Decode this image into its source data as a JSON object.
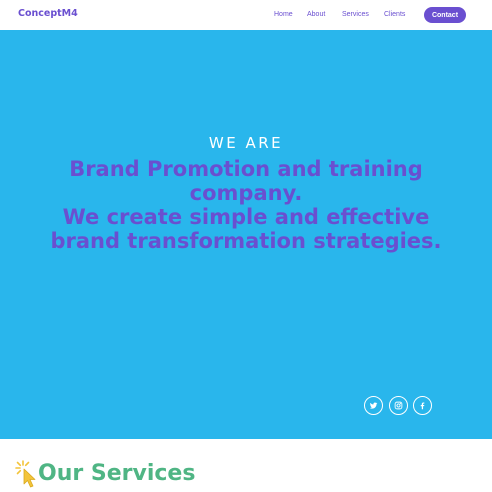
{
  "navbar": {
    "logo": "ConceptM4",
    "links": [
      "Home",
      "About",
      "Services",
      "Clients"
    ],
    "contact_label": "Contact"
  },
  "hero": {
    "kicker": "WE ARE",
    "headline_lines": [
      "Brand Promotion and training",
      "company.",
      "We create simple and effective",
      "brand transformation strategies."
    ]
  },
  "social": [
    "twitter-icon",
    "instagram-icon",
    "facebook-icon"
  ],
  "services": {
    "title": "Our Services"
  },
  "colors": {
    "brand": "#6a4fd0",
    "hero_bg": "#29b6ec",
    "services_title": "#4fb584",
    "cursor_accent": "#f3c43a"
  }
}
